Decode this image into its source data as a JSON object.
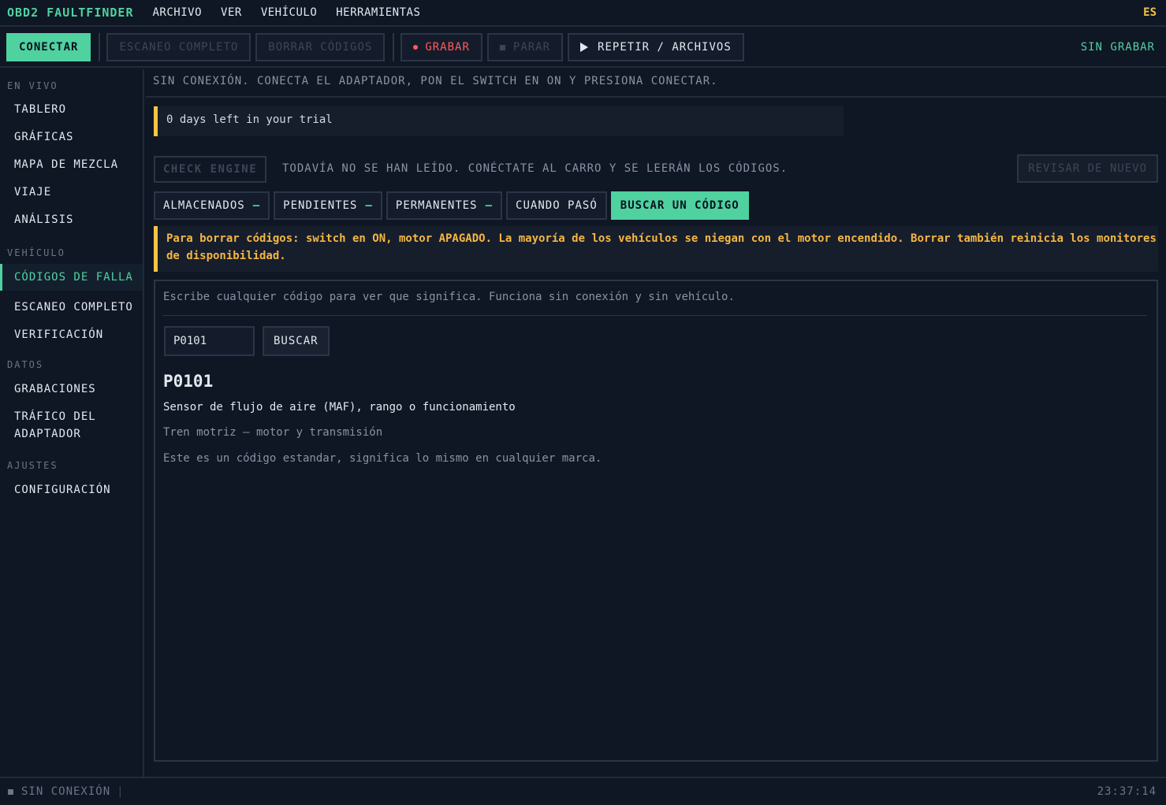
{
  "app": {
    "brand": "OBD2 FAULTFINDER",
    "lang": "ES"
  },
  "menu": [
    "ARCHIVO",
    "VER",
    "VEHÍCULO",
    "HERRAMIENTAS"
  ],
  "toolbar": {
    "connect": "CONECTAR",
    "full_scan": "ESCANEO COMPLETO",
    "clear_codes": "BORRAR CÓDIGOS",
    "record": "GRABAR",
    "stop": "PARAR",
    "replay": "REPETIR / ARCHIVOS",
    "record_status": "SIN GRABAR"
  },
  "sidebar": {
    "sections": {
      "live": "EN VIVO",
      "vehicle": "VEHÍCULO",
      "data": "DATOS",
      "settings": "AJUSTES"
    },
    "live_items": [
      "TABLERO",
      "GRÁFICAS",
      "MAPA DE MEZCLA",
      "VIAJE",
      "ANÁLISIS"
    ],
    "vehicle_items": [
      "CÓDIGOS DE FALLA",
      "ESCANEO COMPLETO",
      "VERIFICACIÓN"
    ],
    "data_items": [
      "GRABACIONES",
      "TRÁFICO DEL ADAPTADOR"
    ],
    "settings_items": [
      "CONFIGURACIÓN"
    ]
  },
  "main": {
    "connection_msg": "SIN CONEXIÓN. CONECTA EL ADAPTADOR, PON EL SWITCH EN ON Y PRESIONA CONECTAR.",
    "trial": "0 days left in your trial",
    "check_engine": "CHECK ENGINE",
    "check_msg": "TODAVÍA NO SE HAN LEÍDO. CONÉCTATE AL CARRO Y SE LEERÁN LOS CÓDIGOS.",
    "recheck": "REVISAR DE NUEVO",
    "tabs": [
      {
        "label": "ALMACENADOS",
        "suffix": "–"
      },
      {
        "label": "PENDIENTES",
        "suffix": "–"
      },
      {
        "label": "PERMANENTES",
        "suffix": "–"
      },
      {
        "label": "CUANDO PASÓ",
        "suffix": ""
      },
      {
        "label": "BUSCAR UN CÓDIGO",
        "suffix": ""
      }
    ],
    "warning": "Para borrar códigos: switch en ON, motor APAGADO. La mayoría de los vehículos se niegan con el motor encendido. Borrar también reinicia los monitores de disponibilidad.",
    "lookup": {
      "hint": "Escribe cualquier código para ver que significa. Funciona sin conexión y sin vehículo.",
      "input_value": "P0101",
      "button": "BUSCAR",
      "code": "P0101",
      "description": "Sensor de flujo de aire (MAF), rango o funcionamiento",
      "category": "Tren motriz — motor y transmisión",
      "note": "Este es un código estandar, significa lo mismo en cualquier marca."
    }
  },
  "status": {
    "connection": "SIN CONEXIÓN",
    "time": "23:37:14"
  },
  "colors": {
    "accent": "#4fd1a0",
    "warning": "#f5c542",
    "record": "#ff5a5a"
  }
}
